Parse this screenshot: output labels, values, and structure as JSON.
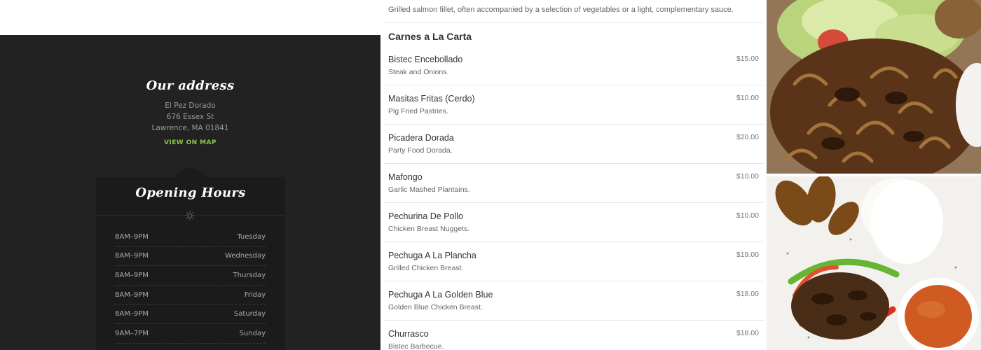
{
  "address": {
    "title": "Our address",
    "lines": [
      "El Pez Dorado",
      "676 Essex St",
      "Lawrence, MA 01841"
    ],
    "map_link": "VIEW ON MAP",
    "link_color": "#8bc34a"
  },
  "hours": {
    "title": "Opening Hours",
    "icon": "sun-icon",
    "rows": [
      {
        "time": "8AM–9PM",
        "day": "Tuesday"
      },
      {
        "time": "8AM–9PM",
        "day": "Wednesday"
      },
      {
        "time": "8AM–9PM",
        "day": "Thursday"
      },
      {
        "time": "8AM–9PM",
        "day": "Friday"
      },
      {
        "time": "8AM–9PM",
        "day": "Saturday"
      },
      {
        "time": "9AM–7PM",
        "day": "Sunday"
      }
    ]
  },
  "menu": {
    "prev_description": "Grilled salmon fillet, often accompanied by a selection of vegetables or a light, complementary sauce.",
    "category": "Carnes a La Carta",
    "items": [
      {
        "name": "Bistec Encebollado",
        "desc": "Steak and Onions.",
        "price": "$15.00"
      },
      {
        "name": "Masitas Fritas (Cerdo)",
        "desc": "Pig Fried Pastries.",
        "price": "$10.00"
      },
      {
        "name": "Picadera Dorada",
        "desc": "Party Food Dorada.",
        "price": "$20.00"
      },
      {
        "name": "Mafongo",
        "desc": "Garlic Mashed Plantains.",
        "price": "$10.00"
      },
      {
        "name": "Pechurina De Pollo",
        "desc": "Chicken Breast Nuggets.",
        "price": "$10.00"
      },
      {
        "name": "Pechuga A La Plancha",
        "desc": "Grilled Chicken Breast.",
        "price": "$19.00"
      },
      {
        "name": "Pechuga A La Golden Blue",
        "desc": "Golden Blue Chicken Breast.",
        "price": "$18.00"
      },
      {
        "name": "Churrasco",
        "desc": "Bistec Barbecue.",
        "price": "$18.00"
      }
    ]
  },
  "colors": {
    "dark_panel": "#222222",
    "hours_card": "#1b1b1b"
  }
}
